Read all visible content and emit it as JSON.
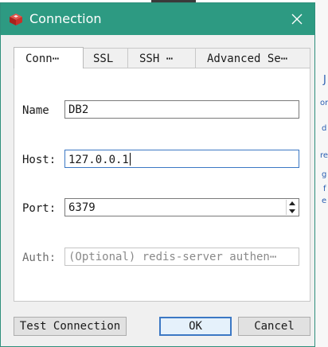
{
  "window": {
    "title": "Connection"
  },
  "tabs": [
    {
      "label": "Conn⋯",
      "active": true
    },
    {
      "label": "SSL",
      "active": false
    },
    {
      "label": "SSH ⋯",
      "active": false
    },
    {
      "label": "Advanced Se⋯",
      "active": false
    }
  ],
  "form": {
    "name": {
      "label": "Name",
      "value": "DB2"
    },
    "host": {
      "label": "Host:",
      "value": "127.0.0.1"
    },
    "port": {
      "label": "Port:",
      "value": "6379"
    },
    "auth": {
      "label": "Auth:",
      "placeholder": "(Optional) redis-server authen⋯"
    }
  },
  "buttons": {
    "test": "Test Connection",
    "ok": "OK",
    "cancel": "Cancel"
  },
  "background": {
    "fragments": [
      "J",
      "or",
      "d",
      "re",
      "g",
      "f",
      "e"
    ]
  },
  "icons": {
    "app": "redis-cube-icon",
    "close": "close-icon",
    "spin": "spinner-icon"
  },
  "colors": {
    "titlebar": "#2d9a82",
    "accent": "#3c78c4",
    "logo": "#d0342c"
  }
}
